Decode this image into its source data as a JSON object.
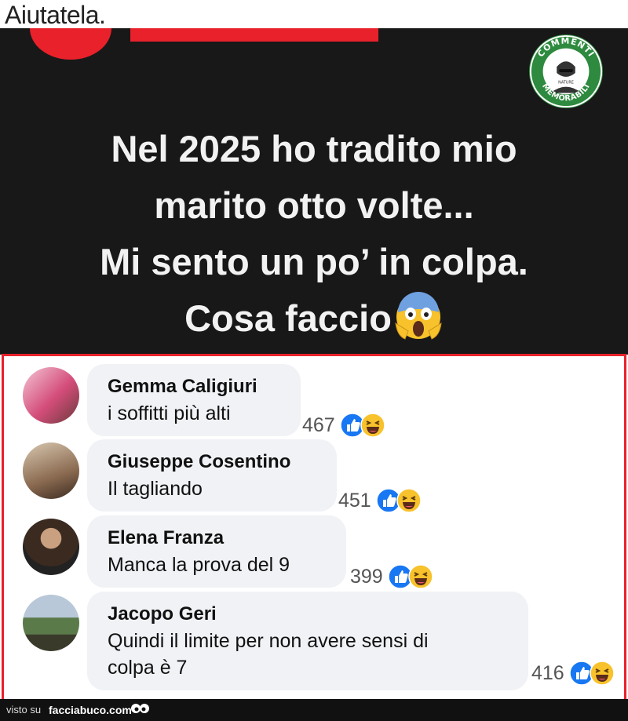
{
  "caption": "Aiutatela.",
  "post": {
    "lines": [
      "Nel 2025 ho tradito mio",
      "marito otto volte...",
      "Mi sento un po’ in colpa.",
      "Cosa faccio"
    ],
    "logo_text_top": "COMMENTI",
    "logo_text_bottom": "MEMORABILI",
    "logo_text_small": "NATURE"
  },
  "comments": [
    {
      "name": "Gemma Caligiuri",
      "text": [
        "i soffitti più alti"
      ],
      "count": "467"
    },
    {
      "name": "Giuseppe Cosentino",
      "text": [
        "Il tagliando"
      ],
      "count": "451"
    },
    {
      "name": "Elena Franza",
      "text": [
        "Manca la prova del 9"
      ],
      "count": "399"
    },
    {
      "name": "Jacopo Geri",
      "text": [
        "Quindi il limite per non avere sensi di",
        "colpa è 7"
      ],
      "count": "416"
    }
  ],
  "footer": {
    "prefix": "visto su",
    "site": "facciabuco.com"
  },
  "colors": {
    "accent_red": "#e8212b",
    "panel": "#181818",
    "bubble": "#f0f2f5",
    "like_blue": "#1877f2",
    "haha_yellow": "#f7c22b"
  },
  "icons": [
    "like-icon",
    "haha-icon",
    "screaming-face-icon",
    "commenti-memorabili-logo"
  ]
}
